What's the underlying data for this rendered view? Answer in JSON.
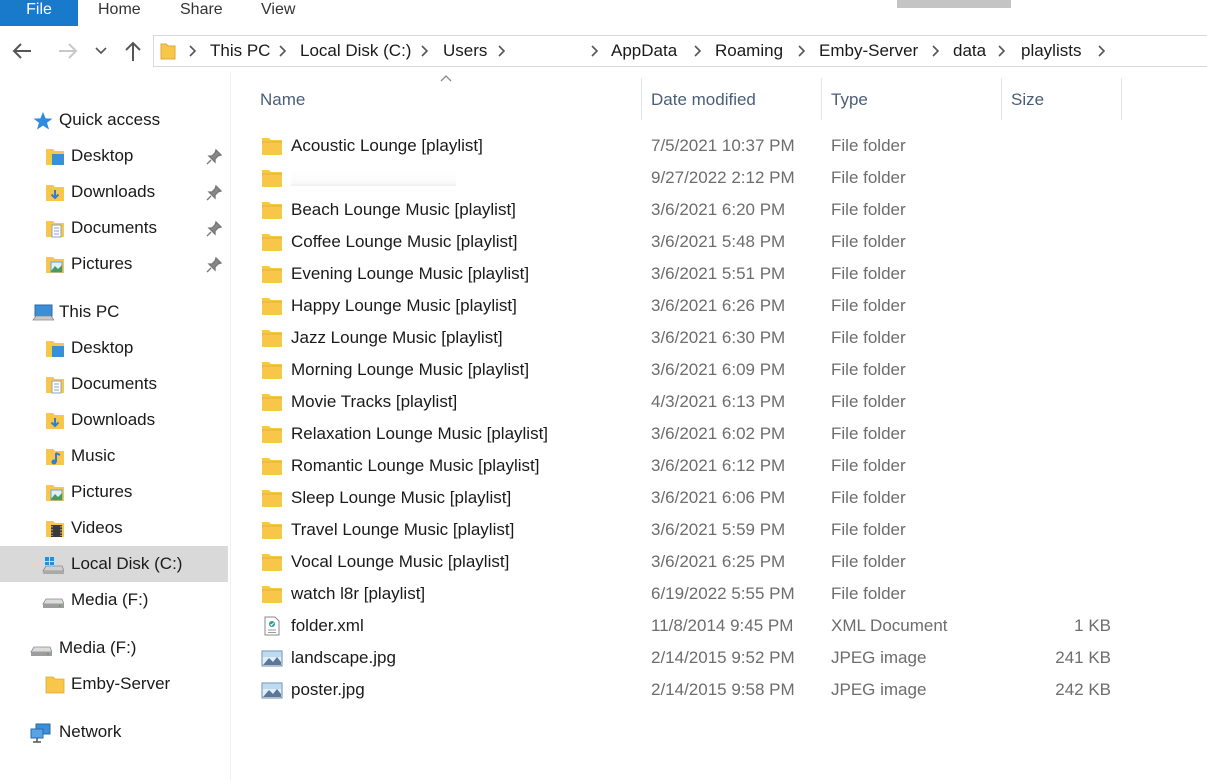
{
  "ribbon": {
    "tabs": [
      "File",
      "Home",
      "Share",
      "View"
    ]
  },
  "navigation": {
    "back_icon": "arrow-left-icon",
    "forward_icon": "arrow-right-icon",
    "recent_icon": "chevron-down-icon",
    "up_icon": "arrow-up-icon",
    "breadcrumbs": [
      "This PC",
      "Local Disk (C:)",
      "Users",
      "",
      "AppData",
      "Roaming",
      "Emby-Server",
      "data",
      "playlists"
    ]
  },
  "sidebar": {
    "quick_access": {
      "label": "Quick access",
      "items": [
        {
          "label": "Desktop",
          "pinned": true
        },
        {
          "label": "Downloads",
          "pinned": true
        },
        {
          "label": "Documents",
          "pinned": true
        },
        {
          "label": "Pictures",
          "pinned": true
        }
      ]
    },
    "this_pc": {
      "label": "This PC",
      "items": [
        {
          "label": "Desktop"
        },
        {
          "label": "Documents"
        },
        {
          "label": "Downloads"
        },
        {
          "label": "Music"
        },
        {
          "label": "Pictures"
        },
        {
          "label": "Videos"
        },
        {
          "label": "Local Disk (C:)",
          "selected": true
        },
        {
          "label": "Media (F:)"
        }
      ]
    },
    "media_drive": {
      "label": "Media (F:)",
      "items": [
        {
          "label": "Emby-Server"
        }
      ]
    },
    "network": {
      "label": "Network"
    }
  },
  "file_list": {
    "columns": {
      "name": "Name",
      "date": "Date modified",
      "type": "Type",
      "size": "Size"
    },
    "sorted_by": "Name",
    "sort_direction": "ascending",
    "rows": [
      {
        "name": "Acoustic Lounge [playlist]",
        "date": "7/5/2021 10:37 PM",
        "type": "File folder",
        "size": "",
        "icon": "folder-icon"
      },
      {
        "name": "",
        "date": "9/27/2022 2:12 PM",
        "type": "File folder",
        "size": "",
        "icon": "folder-icon",
        "redacted": true
      },
      {
        "name": "Beach Lounge Music [playlist]",
        "date": "3/6/2021 6:20 PM",
        "type": "File folder",
        "size": "",
        "icon": "folder-icon"
      },
      {
        "name": "Coffee Lounge Music [playlist]",
        "date": "3/6/2021 5:48 PM",
        "type": "File folder",
        "size": "",
        "icon": "folder-icon"
      },
      {
        "name": "Evening Lounge Music [playlist]",
        "date": "3/6/2021 5:51 PM",
        "type": "File folder",
        "size": "",
        "icon": "folder-icon"
      },
      {
        "name": "Happy Lounge Music [playlist]",
        "date": "3/6/2021 6:26 PM",
        "type": "File folder",
        "size": "",
        "icon": "folder-icon"
      },
      {
        "name": "Jazz Lounge Music [playlist]",
        "date": "3/6/2021 6:30 PM",
        "type": "File folder",
        "size": "",
        "icon": "folder-icon"
      },
      {
        "name": "Morning Lounge Music [playlist]",
        "date": "3/6/2021 6:09 PM",
        "type": "File folder",
        "size": "",
        "icon": "folder-icon"
      },
      {
        "name": "Movie Tracks [playlist]",
        "date": "4/3/2021 6:13 PM",
        "type": "File folder",
        "size": "",
        "icon": "folder-icon"
      },
      {
        "name": "Relaxation Lounge Music [playlist]",
        "date": "3/6/2021 6:02 PM",
        "type": "File folder",
        "size": "",
        "icon": "folder-icon"
      },
      {
        "name": "Romantic Lounge Music [playlist]",
        "date": "3/6/2021 6:12 PM",
        "type": "File folder",
        "size": "",
        "icon": "folder-icon"
      },
      {
        "name": "Sleep Lounge Music [playlist]",
        "date": "3/6/2021 6:06 PM",
        "type": "File folder",
        "size": "",
        "icon": "folder-icon"
      },
      {
        "name": "Travel Lounge Music [playlist]",
        "date": "3/6/2021 5:59 PM",
        "type": "File folder",
        "size": "",
        "icon": "folder-icon"
      },
      {
        "name": "Vocal Lounge Music [playlist]",
        "date": "3/6/2021 6:25 PM",
        "type": "File folder",
        "size": "",
        "icon": "folder-icon"
      },
      {
        "name": "watch l8r [playlist]",
        "date": "6/19/2022 5:55 PM",
        "type": "File folder",
        "size": "",
        "icon": "folder-icon"
      },
      {
        "name": "folder.xml",
        "date": "11/8/2014 9:45 PM",
        "type": "XML Document",
        "size": "1 KB",
        "icon": "xml-file-icon"
      },
      {
        "name": "landscape.jpg",
        "date": "2/14/2015 9:52 PM",
        "type": "JPEG image",
        "size": "241 KB",
        "icon": "image-file-icon"
      },
      {
        "name": "poster.jpg",
        "date": "2/14/2015 9:58 PM",
        "type": "JPEG image",
        "size": "242 KB",
        "icon": "image-file-icon"
      }
    ]
  },
  "colors": {
    "file_tab": "#1979ca",
    "folder": "#f8c74a",
    "folder_dark": "#dca933",
    "selection": "#d9d9d9",
    "header_text": "#4a5e7a",
    "secondary_text": "#6d6d6d"
  }
}
